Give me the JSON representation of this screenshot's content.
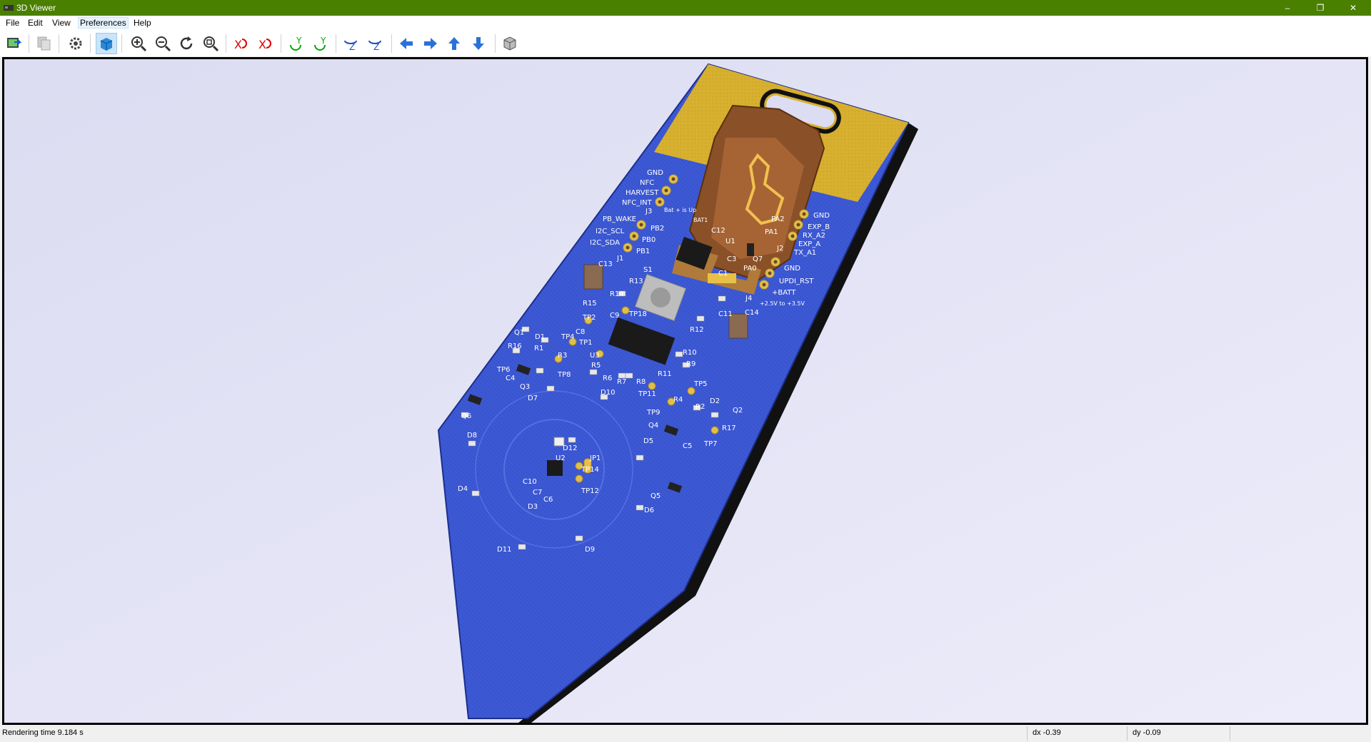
{
  "window": {
    "title": "3D Viewer",
    "minimize": "–",
    "restore": "❐",
    "close": "✕"
  },
  "menu": {
    "file": "File",
    "edit": "Edit",
    "view": "View",
    "preferences": "Preferences",
    "help": "Help"
  },
  "board": {
    "labels": {
      "gnd1": "GND",
      "nfc": "NFC",
      "harvest": "HARVEST",
      "nfc_int": "NFC_INT",
      "j3": "J3",
      "bat_up": "Bat + is Up",
      "bat1": "BAT1",
      "pb_wake": "PB_WAKE",
      "pb2": "PB2",
      "i2c_scl": "I2C_SCL",
      "pb0": "PB0",
      "i2c_sda": "I2C_SDA",
      "pb1": "PB1",
      "j1": "J1",
      "gnd2": "GND",
      "pa2": "PA2",
      "exp_b": "EXP_B",
      "pa1": "PA1",
      "rx_a2": "RX_A2",
      "exp_a": "EXP_A",
      "tx_a1": "TX_A1",
      "j2": "J2",
      "q7": "Q7",
      "gnd3": "GND",
      "pa0": "PA0",
      "updi_rst": "UPDI_RST",
      "batt": "+BATT",
      "batt_range": "+2.5V to +3.5V",
      "j4": "J4",
      "c12": "C12",
      "u1": "U1",
      "c3": "C3",
      "c1": "C1",
      "c13": "C13",
      "s1": "S1",
      "r13": "R13",
      "r14": "R14",
      "r15": "R15",
      "tp18": "TP18",
      "c9": "C9",
      "c11": "C11",
      "c14": "C14",
      "r12": "R12",
      "tp2": "TP2",
      "c8": "C8",
      "tp1": "TP1",
      "u3": "U3",
      "r10": "R10",
      "r9": "R9",
      "r11": "R11",
      "q1": "Q1",
      "d1": "D1",
      "tp4": "TP4",
      "r16": "R16",
      "r1": "R1",
      "r3": "R3",
      "tp6": "TP6",
      "tp8": "TP8",
      "c4": "C4",
      "q3": "Q3",
      "r5": "R5",
      "r6": "R6",
      "r7": "R7",
      "r8": "R8",
      "tp11": "TP11",
      "d7": "D7",
      "d10": "D10",
      "tp5": "TP5",
      "r4": "R4",
      "r2": "R2",
      "d2": "D2",
      "q2": "Q2",
      "q6": "Q6",
      "tp9": "TP9",
      "q4": "Q4",
      "r17": "R17",
      "c5": "C5",
      "tp7": "TP7",
      "d8": "D8",
      "d12": "D12",
      "d5": "D5",
      "u2": "U2",
      "jp1": "JP1",
      "tp14": "TP14",
      "c10": "C10",
      "tp12": "TP12",
      "c7": "C7",
      "c6": "C6",
      "d4": "D4",
      "q5": "Q5",
      "d3": "D3",
      "d6": "D6",
      "d11": "D11",
      "d9": "D9"
    }
  },
  "status": {
    "render_time": "Rendering time 9.184 s",
    "dx": "dx -0.39",
    "dy": "dy -0.09"
  },
  "colors": {
    "titlebar": "#4a7f00",
    "viewport_bg": "#e8e8f8",
    "pcb": "#3a55d0",
    "copper_pour": "#d8b030",
    "battery_holder": "#8a5028"
  },
  "icons": [
    "export-icon",
    "copy-icon",
    "settings-icon",
    "raytrace-icon",
    "zoom-in-icon",
    "zoom-out-icon",
    "redraw-icon",
    "zoom-fit-icon",
    "rotate-x-cw-icon",
    "rotate-x-ccw-icon",
    "rotate-y-cw-icon",
    "rotate-y-ccw-icon",
    "rotate-z-cw-icon",
    "rotate-z-ccw-icon",
    "move-left-icon",
    "move-right-icon",
    "move-up-icon",
    "move-down-icon",
    "ortho-toggle-icon"
  ]
}
